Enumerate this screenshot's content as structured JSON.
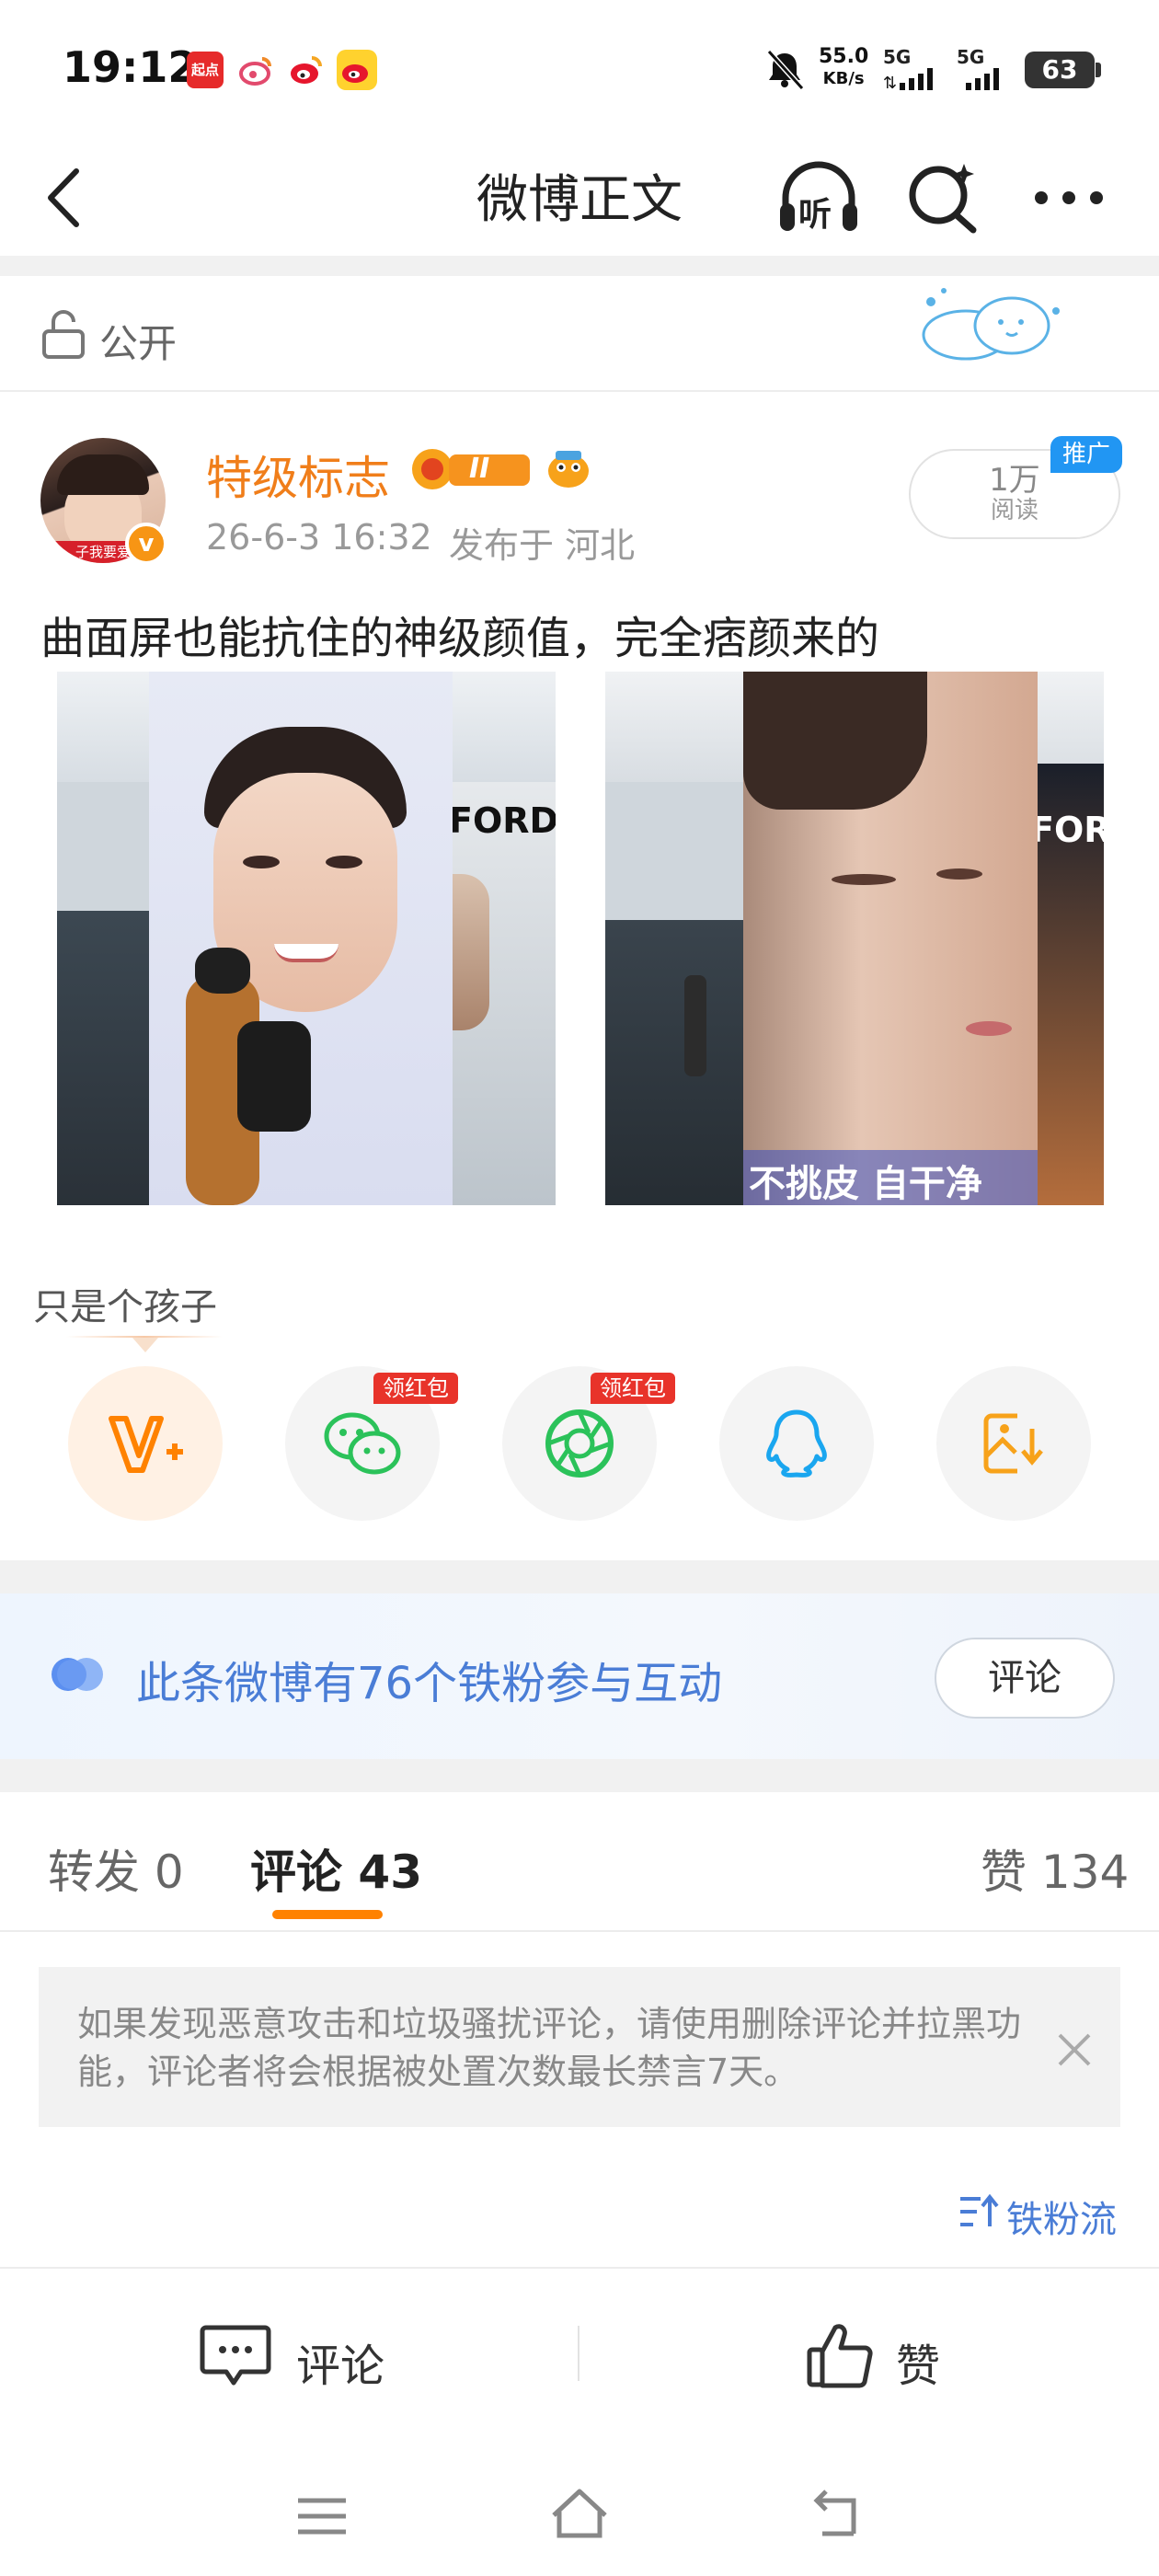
{
  "status_bar": {
    "time": "19:12",
    "app_icons": [
      "qidian-icon",
      "weibo-alt-icon",
      "weibo-icon",
      "weibo-yellow-icon"
    ],
    "qidian_label": "起点",
    "net_speed_value": "55.0",
    "net_speed_unit": "KB/s",
    "signal1": "5G",
    "signal2": "5G",
    "battery": "63"
  },
  "header": {
    "title": "微博正文",
    "listen_label": "听"
  },
  "visibility": {
    "label": "公开"
  },
  "post": {
    "author": "特级标志",
    "badge_level": "II",
    "timestamp": "26-6-3 16:32",
    "location": "发布于 河北",
    "reads_value": "1万",
    "reads_label": "阅读",
    "promo_badge": "推广",
    "text": "曲面屏也能抗住的神级颜值，完全痞颜来的",
    "image2_overlay_text": "不挑皮 自干净",
    "image_brand": "FORD",
    "image2_brand": "FOR",
    "avatar_text": "子我要爱"
  },
  "share": {
    "tooltip": "只是个孩子",
    "items": [
      {
        "name": "repost-vip",
        "icon": "v-plus-icon"
      },
      {
        "name": "wechat",
        "icon": "wechat-icon",
        "badge": "领红包"
      },
      {
        "name": "moments",
        "icon": "moments-icon",
        "badge": "领红包"
      },
      {
        "name": "qq",
        "icon": "qq-icon"
      },
      {
        "name": "save-image",
        "icon": "save-image-icon"
      }
    ]
  },
  "fans_banner": {
    "text": "此条微博有76个铁粉参与互动",
    "button": "评论"
  },
  "tabs": {
    "repost": "转发 0",
    "comments": "评论 43",
    "likes": "赞 134"
  },
  "notice": {
    "text": "如果发现恶意攻击和垃圾骚扰评论，请使用删除评论并拉黑功能，评论者将会根据被处置次数最长禁言7天。"
  },
  "sort": {
    "label": "铁粉流"
  },
  "bottom_bar": {
    "comment": "评论",
    "like": "赞"
  },
  "colors": {
    "accent_orange": "#ff8200",
    "author_orange": "#f07e1a",
    "fans_blue": "#4a7dd6",
    "red_badge": "#e8332a",
    "wechat_green": "#2bc25a",
    "qq_blue": "#1aa6ef",
    "save_orange": "#f7a21a"
  }
}
